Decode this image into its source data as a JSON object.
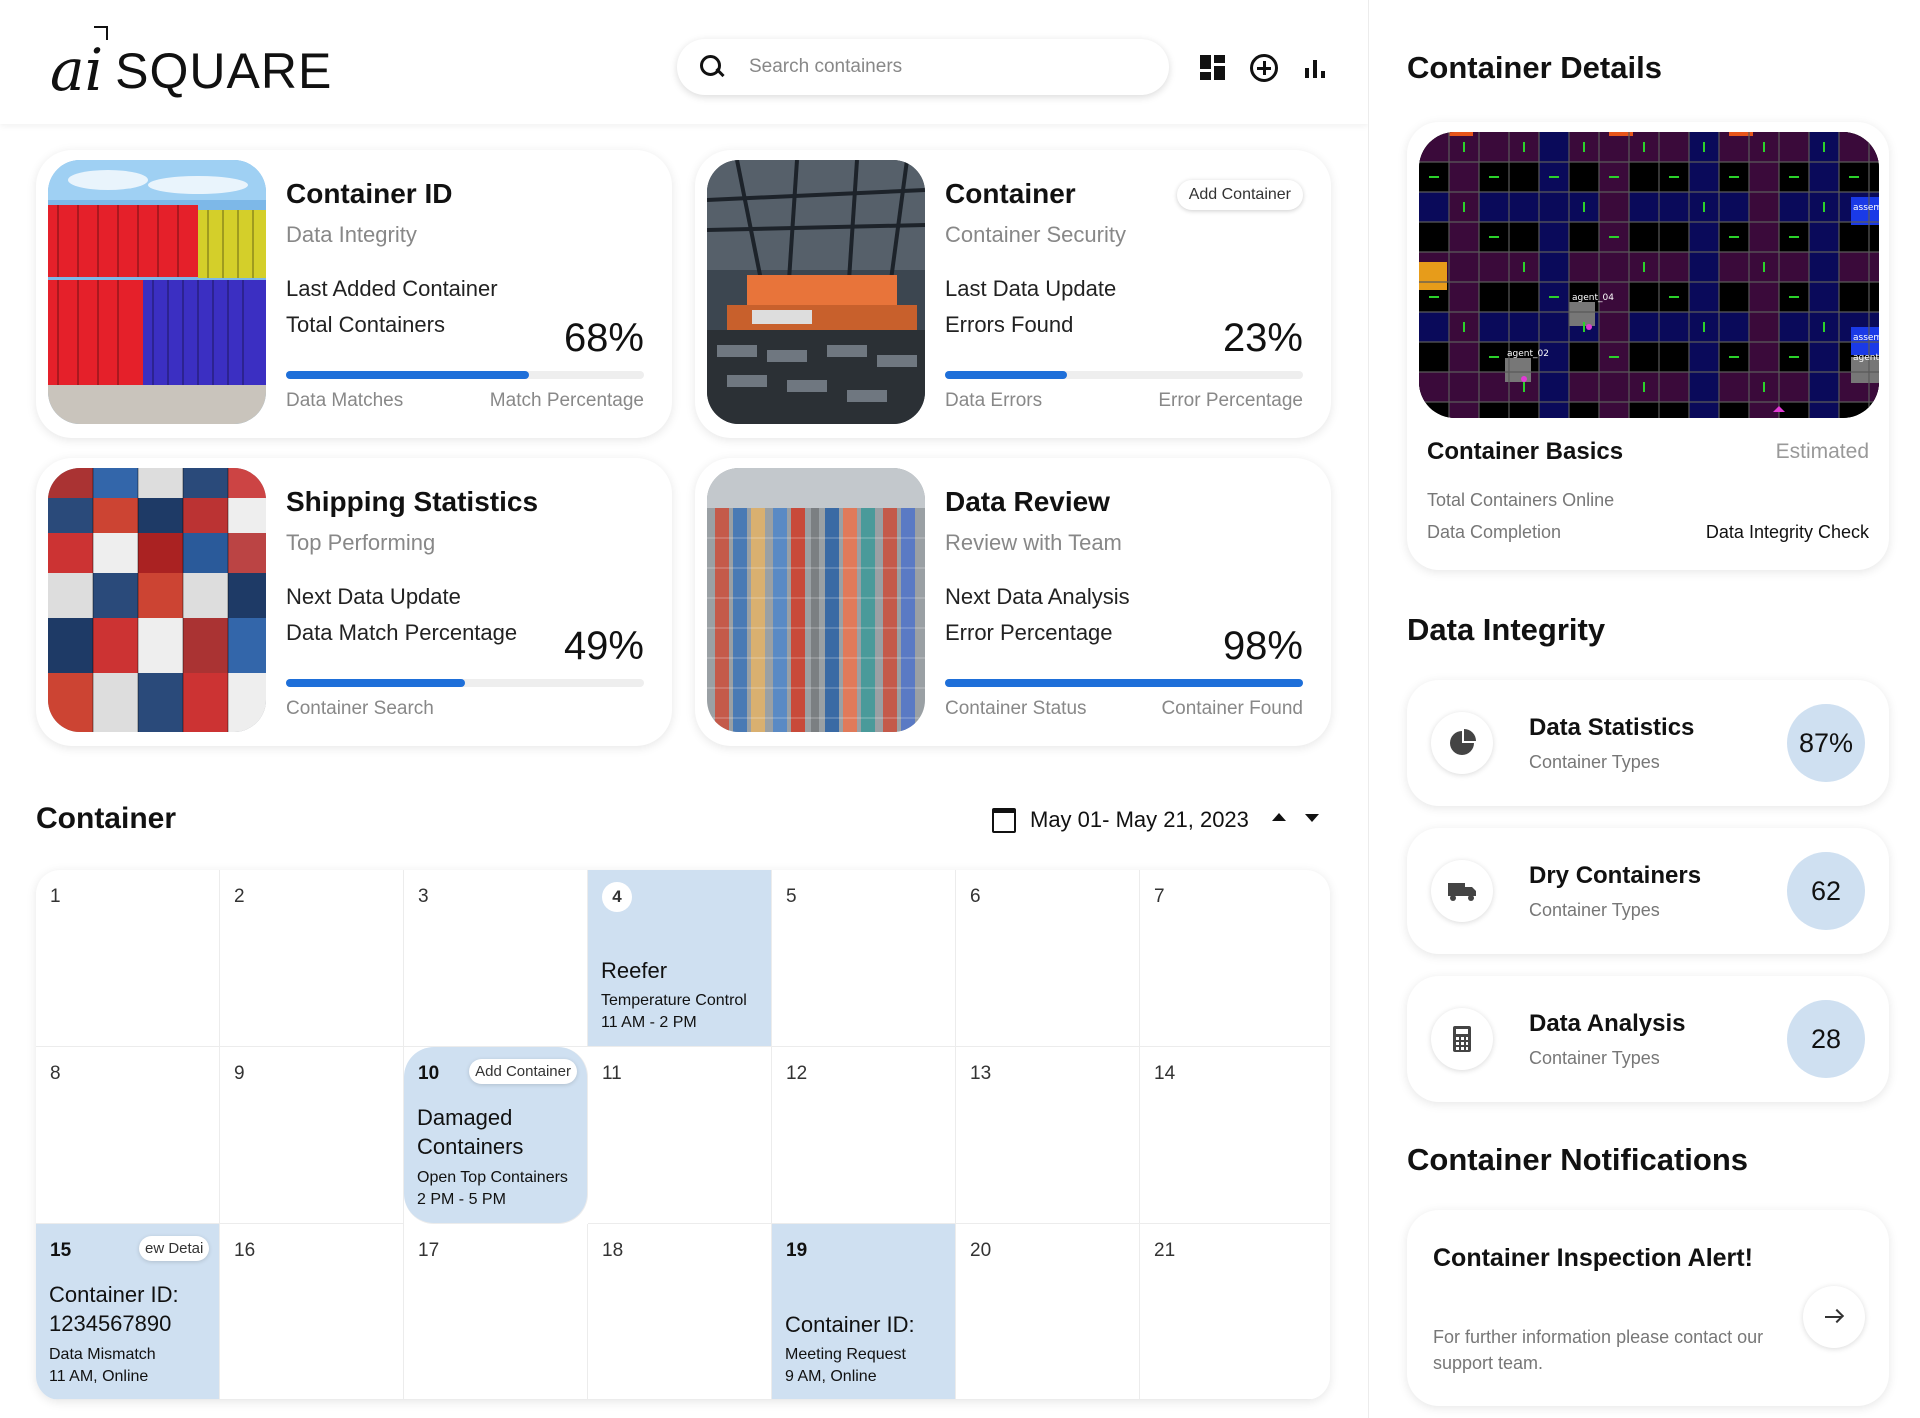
{
  "brand": {
    "ai": "ai",
    "name": "SQUARE"
  },
  "search": {
    "placeholder": "Search containers"
  },
  "cards": [
    {
      "title": "Container ID",
      "subtitle": "Data Integrity",
      "line1": "Last Added Container",
      "line2": "Total Containers",
      "percent": "68%",
      "progress": 0.68,
      "foot_left": "Data Matches",
      "foot_right": "Match Percentage"
    },
    {
      "title": "Container",
      "subtitle": "Container Security",
      "line1": "Last Data Update",
      "line2": "Errors Found",
      "percent": "23%",
      "progress": 0.34,
      "foot_left": "Data Errors",
      "foot_right": "Error Percentage",
      "badge": "Add Container"
    },
    {
      "title": "Shipping Statistics",
      "subtitle": "Top Performing",
      "line1": "Next Data Update",
      "line2": "Data Match Percentage",
      "percent": "49%",
      "progress": 0.5,
      "foot_left": "Container Search",
      "foot_right": ""
    },
    {
      "title": "Data Review",
      "subtitle": "Review with Team",
      "line1": "Next Data Analysis",
      "line2": "Error Percentage",
      "percent": "98%",
      "progress": 1.0,
      "foot_left": "Container Status",
      "foot_right": "Container Found"
    }
  ],
  "calendar": {
    "title": "Container",
    "range": "May 01- May 21, 2023",
    "days": [
      "1",
      "2",
      "3",
      "4",
      "5",
      "6",
      "7",
      "8",
      "9",
      "10",
      "11",
      "12",
      "13",
      "14",
      "15",
      "16",
      "17",
      "18",
      "19",
      "20",
      "21"
    ],
    "events": {
      "4": {
        "title": "Reefer",
        "sub1": "Temperature Control",
        "sub2": "11 AM - 2 PM"
      },
      "10": {
        "badge": "Add Container",
        "title1": "Damaged",
        "title2": "Containers",
        "sub1": "Open Top Containers",
        "sub2": "2 PM - 5 PM"
      },
      "15": {
        "badge": "ew Detai",
        "title1": "Container ID:",
        "title2": "1234567890",
        "sub1": "Data Mismatch",
        "sub2": "11 AM, Online"
      },
      "19": {
        "title": "Container ID:",
        "sub1": "Meeting Request",
        "sub2": "9 AM, Online"
      }
    }
  },
  "panel": {
    "details_title": "Container Details",
    "basics": {
      "title": "Container Basics",
      "estimated": "Estimated",
      "line1": "Total Containers Online",
      "line2": "Data Completion",
      "right2": "Data Integrity Check"
    },
    "grid_labels": {
      "agent_04": "agent_04",
      "agent_02": "agent_02",
      "agent_right": "agent_",
      "assem1": "assem",
      "assem2": "assem"
    },
    "integrity_title": "Data Integrity",
    "integrity": [
      {
        "title": "Data Statistics",
        "sub": "Container Types",
        "value": "87%",
        "icon": "pie-chart-icon"
      },
      {
        "title": "Dry Containers",
        "sub": "Container Types",
        "value": "62",
        "icon": "truck-icon"
      },
      {
        "title": "Data Analysis",
        "sub": "Container Types",
        "value": "28",
        "icon": "calculator-icon"
      }
    ],
    "notifications_title": "Container Notifications",
    "notification": {
      "title": "Container Inspection Alert!",
      "body": "For further information please contact our support team."
    }
  },
  "colors": {
    "accent": "#1e6fd9",
    "event_bg": "#cfe0f1"
  }
}
